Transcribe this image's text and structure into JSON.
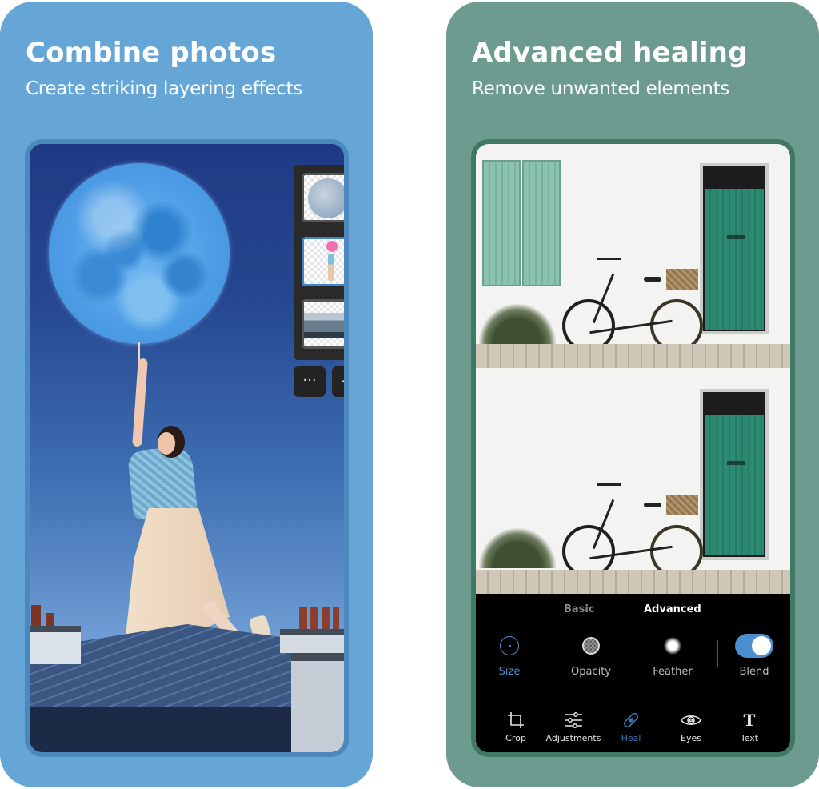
{
  "left_card": {
    "title": "Combine photos",
    "subtitle": "Create striking layering effects",
    "background_color": "#66a6d6",
    "layers_panel": {
      "layers": [
        {
          "name": "moon",
          "selected": false
        },
        {
          "name": "girl-with-balloons",
          "selected": true
        },
        {
          "name": "city-rooftops",
          "selected": false
        }
      ],
      "more_label": "···",
      "add_label": "+"
    }
  },
  "right_card": {
    "title": "Advanced healing",
    "subtitle": "Remove unwanted elements",
    "background_color": "#6e9b8f",
    "heal_panel": {
      "modes": [
        {
          "label": "Basic",
          "active": false
        },
        {
          "label": "Advanced",
          "active": true
        }
      ],
      "tools": [
        {
          "label": "Size",
          "icon": "size-circle-icon",
          "active": true
        },
        {
          "label": "Opacity",
          "icon": "opacity-checker-icon",
          "active": false
        },
        {
          "label": "Feather",
          "icon": "feather-glow-icon",
          "active": false
        },
        {
          "label": "Blend",
          "icon": "toggle-switch",
          "active": false,
          "toggle_on": true
        }
      ]
    },
    "bottom_nav": [
      {
        "label": "Crop",
        "icon": "crop-icon",
        "active": false
      },
      {
        "label": "Adjustments",
        "icon": "sliders-icon",
        "active": false
      },
      {
        "label": "Heal",
        "icon": "bandage-icon",
        "active": true
      },
      {
        "label": "Eyes",
        "icon": "eye-icon",
        "active": false
      },
      {
        "label": "Text",
        "icon": "text-t-icon",
        "active": false
      }
    ],
    "accent_color": "#4b8fd1"
  }
}
